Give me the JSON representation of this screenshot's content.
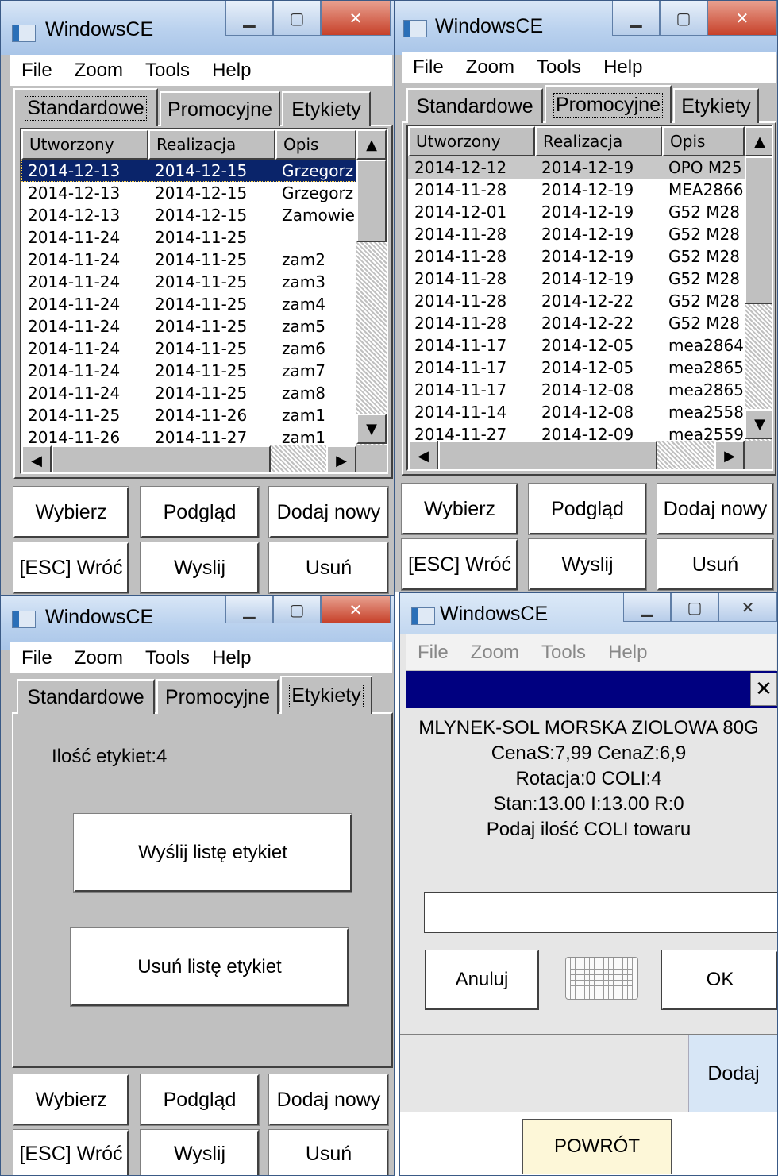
{
  "window_title": "WindowsCE",
  "menu": [
    "File",
    "Zoom",
    "Tools",
    "Help"
  ],
  "tabs": [
    "Standardowe",
    "Promocyjne",
    "Etykiety"
  ],
  "columns": [
    "Utworzony",
    "Realizacja",
    "Opis"
  ],
  "buttons": {
    "wybierz": "Wybierz",
    "podglad": "Podgląd",
    "dodaj_nowy": "Dodaj nowy",
    "wroc": "[ESC] Wróć",
    "wyslij": "Wyslij",
    "usun": "Usuń"
  },
  "icons": {
    "minimize": "minimize-icon",
    "maximize": "maximize-icon",
    "close": "close-icon"
  },
  "standardowe_rows": [
    [
      "2014-12-13",
      "2014-12-15",
      "Grzegorz"
    ],
    [
      "2014-12-13",
      "2014-12-15",
      "Grzegorz"
    ],
    [
      "2014-12-13",
      "2014-12-15",
      "Zamowieı"
    ],
    [
      "2014-11-24",
      "2014-11-25",
      ""
    ],
    [
      "2014-11-24",
      "2014-11-25",
      "zam2"
    ],
    [
      "2014-11-24",
      "2014-11-25",
      "zam3"
    ],
    [
      "2014-11-24",
      "2014-11-25",
      "zam4"
    ],
    [
      "2014-11-24",
      "2014-11-25",
      "zam5"
    ],
    [
      "2014-11-24",
      "2014-11-25",
      "zam6"
    ],
    [
      "2014-11-24",
      "2014-11-25",
      "zam7"
    ],
    [
      "2014-11-24",
      "2014-11-25",
      "zam8"
    ],
    [
      "2014-11-25",
      "2014-11-26",
      "zam1"
    ],
    [
      "2014-11-26",
      "2014-11-27",
      "zam1"
    ]
  ],
  "promocyjne_rows": [
    [
      "2014-12-12",
      "2014-12-19",
      "OPO M25"
    ],
    [
      "2014-11-28",
      "2014-12-19",
      "MEA2866"
    ],
    [
      "2014-12-01",
      "2014-12-19",
      "G52 M28"
    ],
    [
      "2014-11-28",
      "2014-12-19",
      "G52 M28"
    ],
    [
      "2014-11-28",
      "2014-12-19",
      "G52 M28"
    ],
    [
      "2014-11-28",
      "2014-12-19",
      "G52 M28"
    ],
    [
      "2014-11-28",
      "2014-12-22",
      "G52 M28"
    ],
    [
      "2014-11-28",
      "2014-12-22",
      "G52 M28"
    ],
    [
      "2014-11-17",
      "2014-12-05",
      "mea2864"
    ],
    [
      "2014-11-17",
      "2014-12-05",
      "mea2865"
    ],
    [
      "2014-11-17",
      "2014-12-08",
      "mea2865"
    ],
    [
      "2014-11-14",
      "2014-12-08",
      "mea2558"
    ],
    [
      "2014-11-27",
      "2014-12-09",
      "mea2559"
    ]
  ],
  "etykiety": {
    "count_label": "Ilość etykiet:4",
    "send_button": "Wyślij listę etykiet",
    "delete_button": "Usuń listę etykiet"
  },
  "dialog": {
    "product_name": "MLYNEK-SOL MORSKA ZIOLOWA 80G",
    "prices": "CenaS:7,99   CenaZ:6,9",
    "rotation": "Rotacja:0   COLI:4",
    "stock": "Stan:13.00  I:13.00  R:0",
    "prompt": "Podaj ilość COLI towaru",
    "quantity_value": "",
    "cancel_button": "Anuluj",
    "ok_button": "OK",
    "close_glyph": "✕",
    "add_button": "Dodaj",
    "back_button": "POWRÓT"
  }
}
